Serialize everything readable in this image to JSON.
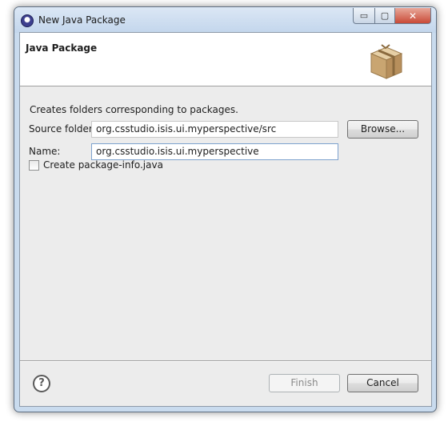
{
  "window": {
    "title": "New Java Package",
    "controls": {
      "minimize": "▭",
      "maximize": "▢",
      "close": "✕"
    }
  },
  "header": {
    "title": "Java Package",
    "icon": "package-icon"
  },
  "description": "Creates folders corresponding to packages.",
  "form": {
    "source_folder": {
      "label": "Source folder:",
      "value": "org.csstudio.isis.ui.myperspective/src",
      "browse_label": "Browse..."
    },
    "name": {
      "label": "Name:",
      "value": "org.csstudio.isis.ui.myperspective"
    },
    "package_info": {
      "label": "Create package-info.java",
      "checked": false
    }
  },
  "footer": {
    "help_glyph": "?",
    "finish_label": "Finish",
    "cancel_label": "Cancel"
  }
}
